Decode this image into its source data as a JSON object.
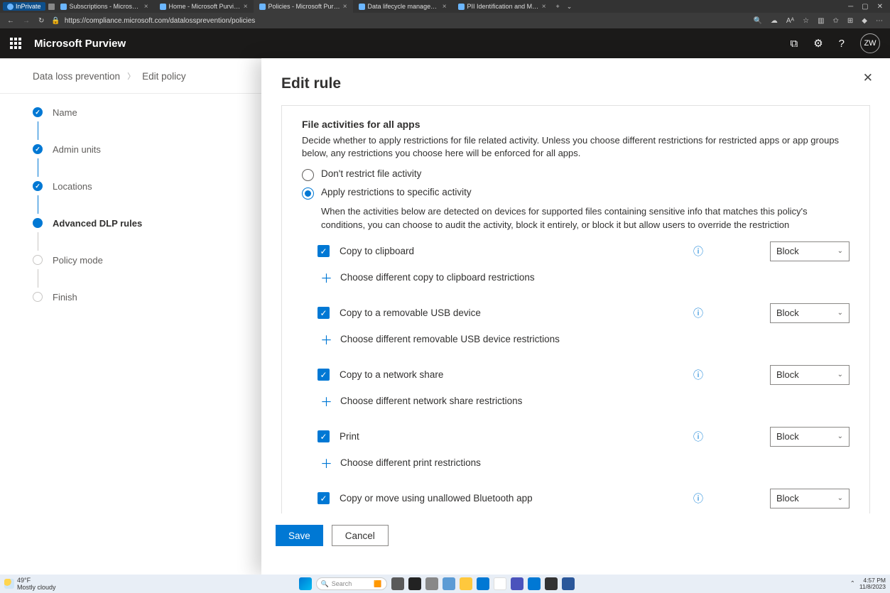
{
  "browser": {
    "inprivate": "InPrivate",
    "tabs": [
      {
        "label": "Subscriptions - Microsoft 365 a..."
      },
      {
        "label": "Home - Microsoft Purview"
      },
      {
        "label": "Policies - Microsoft Purview"
      },
      {
        "label": "Data lifecycle management - M..."
      },
      {
        "label": "PII Identification and Minimizat..."
      }
    ],
    "url": "https://compliance.microsoft.com/datalossprevention/policies"
  },
  "header": {
    "appname": "Microsoft Purview",
    "avatar": "ZW"
  },
  "breadcrumb": {
    "a": "Data loss prevention",
    "b": "Edit policy"
  },
  "stepper": [
    {
      "label": "Name",
      "state": "done"
    },
    {
      "label": "Admin units",
      "state": "done"
    },
    {
      "label": "Locations",
      "state": "done"
    },
    {
      "label": "Advanced DLP rules",
      "state": "current"
    },
    {
      "label": "Policy mode",
      "state": "todo"
    },
    {
      "label": "Finish",
      "state": "todo"
    }
  ],
  "panel": {
    "title": "Edit rule",
    "section_title": "File activities for all apps",
    "section_desc": "Decide whether to apply restrictions for file related activity. Unless you choose different restrictions for restricted apps or app groups below, any restrictions you choose here will be enforced for all apps.",
    "radio_none": "Don't restrict file activity",
    "radio_apply": "Apply restrictions to specific activity",
    "radio_apply_desc": "When the activities below are detected on devices for supported files containing sensitive info that matches this policy's conditions, you can choose to audit the activity, block it entirely, or block it but allow users to override the restriction",
    "activities": [
      {
        "label": "Copy to clipboard",
        "action": "Block",
        "add": "Choose different copy to clipboard restrictions"
      },
      {
        "label": "Copy to a removable USB device",
        "action": "Block",
        "add": "Choose different removable USB device restrictions"
      },
      {
        "label": "Copy to a network share",
        "action": "Block",
        "add": "Choose different network share restrictions"
      },
      {
        "label": "Print",
        "action": "Block",
        "add": "Choose different print restrictions"
      },
      {
        "label": "Copy or move using unallowed Bluetooth app",
        "action": "Block",
        "add": ""
      }
    ],
    "save": "Save",
    "cancel": "Cancel"
  },
  "taskbar": {
    "temp": "49°F",
    "cond": "Mostly cloudy",
    "search_placeholder": "Search",
    "time": "4:57 PM",
    "date": "11/8/2023"
  }
}
